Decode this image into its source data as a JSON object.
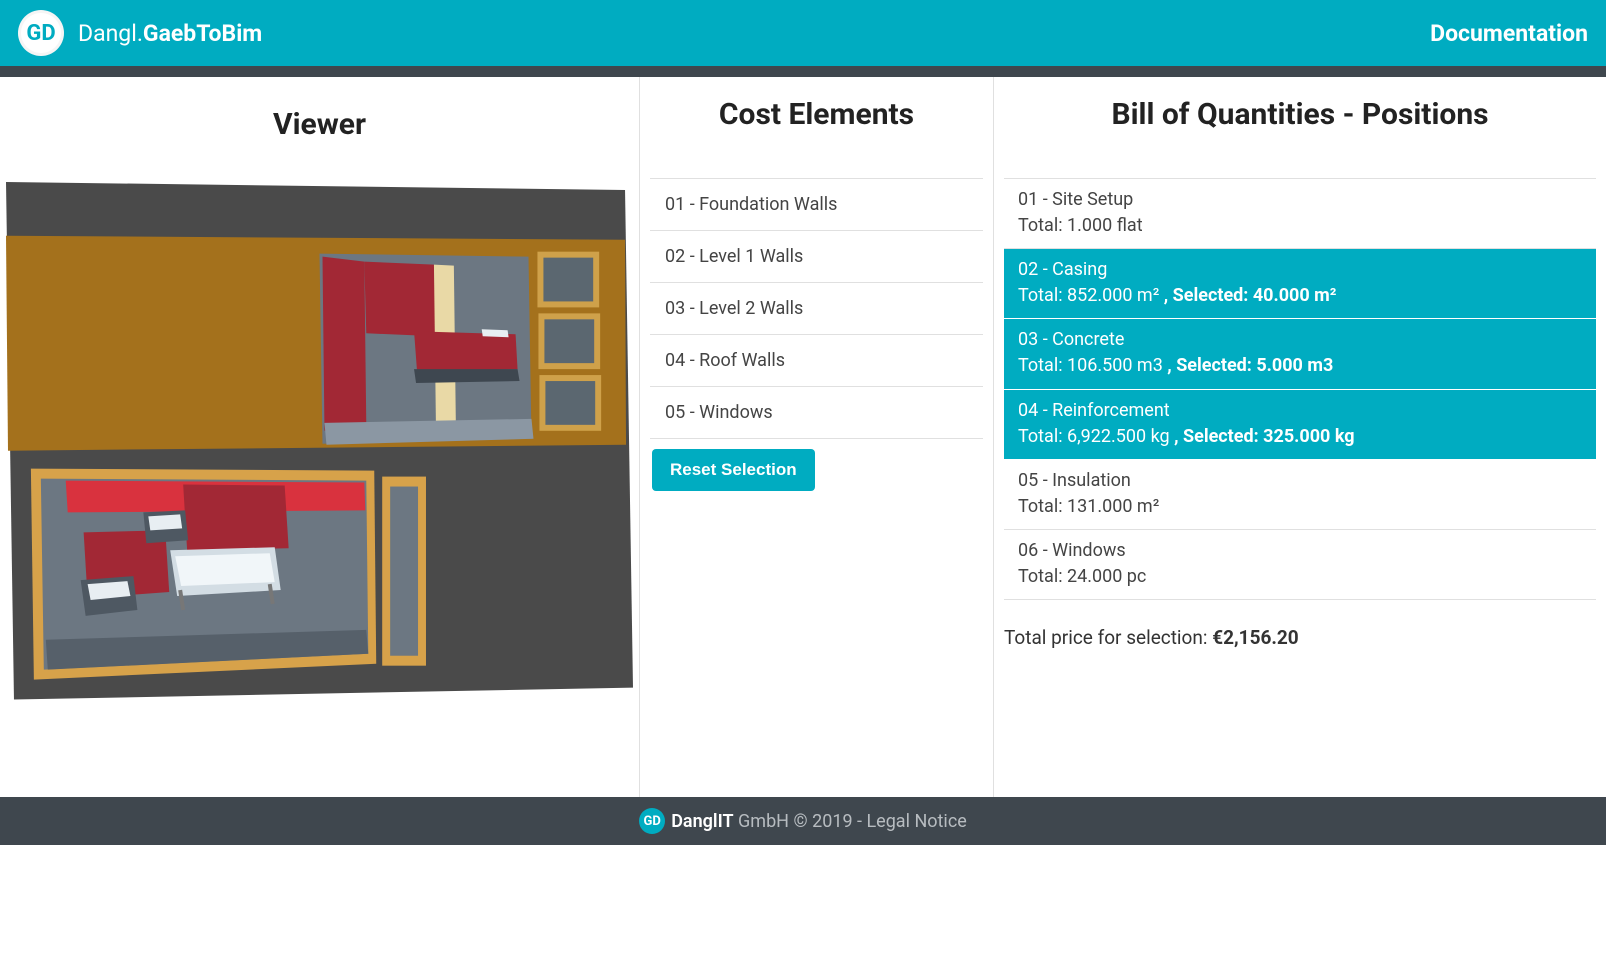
{
  "header": {
    "logo_initials": "GD",
    "brand_prefix": "Dangl.",
    "brand_suffix": "GaebToBim",
    "doc_link": "Documentation"
  },
  "columns": {
    "viewer_title": "Viewer",
    "cost_title": "Cost Elements",
    "boq_title": "Bill of Quantities - Positions"
  },
  "cost_elements": [
    {
      "label": "01 - Foundation Walls"
    },
    {
      "label": "02 - Level 1 Walls"
    },
    {
      "label": "03 - Level 2 Walls"
    },
    {
      "label": "04 - Roof Walls"
    },
    {
      "label": "05 - Windows"
    }
  ],
  "boq_positions": [
    {
      "label": "01 - Site Setup",
      "total": "Total: 1.000 flat",
      "selected": false
    },
    {
      "label": "02 - Casing",
      "total": "Total: 852.000 m² ",
      "selected": true,
      "selected_text": ", Selected: 40.000 m²"
    },
    {
      "label": "03 - Concrete",
      "total": "Total: 106.500 m3 ",
      "selected": true,
      "selected_text": ", Selected: 5.000 m3"
    },
    {
      "label": "04 - Reinforcement",
      "total": "Total: 6,922.500 kg ",
      "selected": true,
      "selected_text": ", Selected: 325.000 kg"
    },
    {
      "label": "05 - Insulation",
      "total": "Total: 131.000 m²",
      "selected": false
    },
    {
      "label": "06 - Windows",
      "total": "Total: 24.000 pc",
      "selected": false
    }
  ],
  "reset_button": "Reset Selection",
  "total_price_prefix": "Total price for selection: ",
  "total_price_amount": "€2,156.20",
  "footer": {
    "logo_initials": "GD",
    "brand": "DanglIT",
    "rest": " GmbH © 2019 - Legal Notice"
  }
}
